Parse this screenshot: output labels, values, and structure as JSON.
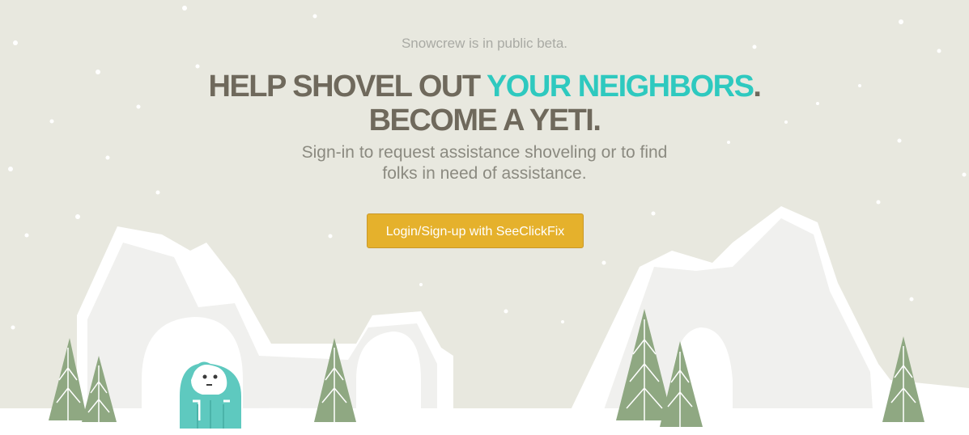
{
  "banner": {
    "beta_text": "Snowcrew is in public beta."
  },
  "hero": {
    "headline_part1": "HELP SHOVEL OUT ",
    "headline_highlight": "YOUR NEIGHBORS",
    "headline_end": ".",
    "headline_line2": "BECOME A YETI.",
    "subtitle_line1": "Sign-in to request assistance shoveling or to find",
    "subtitle_line2": "folks in need of assistance."
  },
  "actions": {
    "login_button_label": "Login/Sign-up with SeeClickFix"
  },
  "colors": {
    "background": "#e8e8df",
    "headline": "#6f695c",
    "highlight": "#2ec9bf",
    "button": "#e5b12c",
    "tree": "#8fa882",
    "yeti": "#5ec9bf"
  },
  "icons": {
    "mascot": "yeti-icon",
    "trees": "pine-tree-icon",
    "mountains": "mountain-icon"
  }
}
